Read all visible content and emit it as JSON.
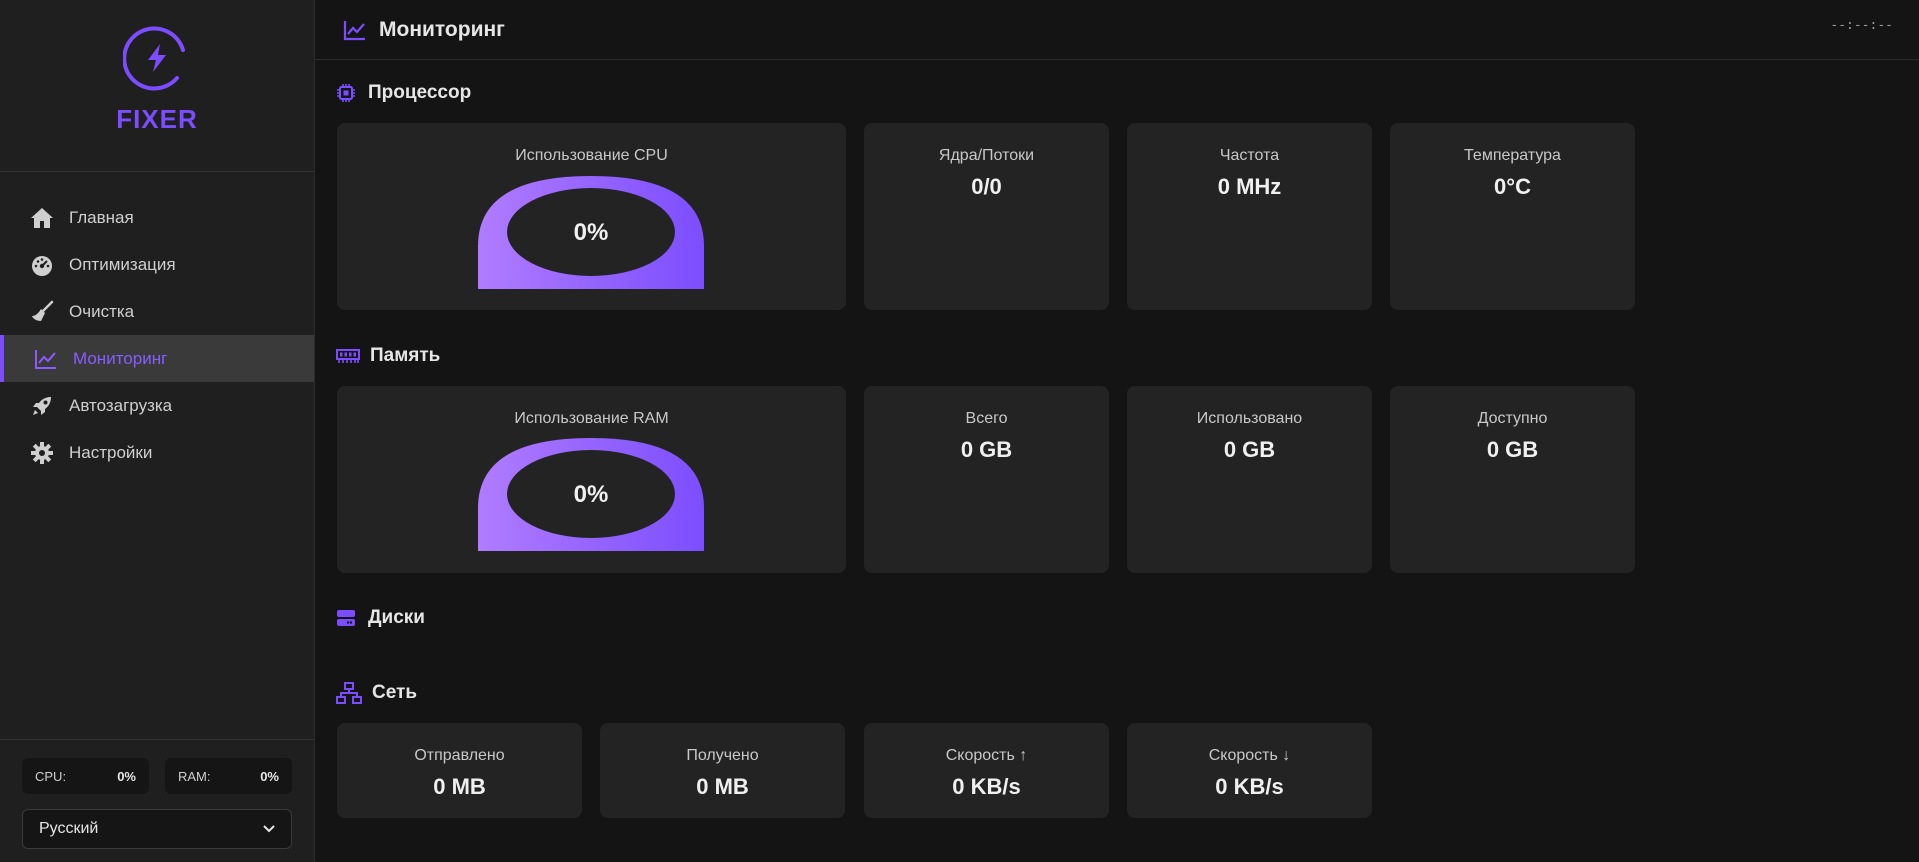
{
  "app": {
    "logo_text": "FIXER",
    "accent_color": "#7c4dff"
  },
  "sidebar": {
    "items": [
      {
        "label": "Главная",
        "icon": "home-icon"
      },
      {
        "label": "Оптимизация",
        "icon": "speedometer-icon"
      },
      {
        "label": "Очистка",
        "icon": "broom-icon"
      },
      {
        "label": "Мониторинг",
        "icon": "chart-line-icon",
        "active": true
      },
      {
        "label": "Автозагрузка",
        "icon": "rocket-icon"
      },
      {
        "label": "Настройки",
        "icon": "gear-icon"
      }
    ],
    "cpu_label": "CPU:",
    "cpu_value": "0%",
    "ram_label": "RAM:",
    "ram_value": "0%",
    "language": "Русский"
  },
  "header": {
    "title": "Мониторинг",
    "clock": "--:--:--"
  },
  "processor": {
    "title": "Процессор",
    "usage_label": "Использование CPU",
    "usage_value": "0%",
    "cards": [
      {
        "label": "Ядра/Потоки",
        "value": "0/0"
      },
      {
        "label": "Частота",
        "value": "0 MHz"
      },
      {
        "label": "Температура",
        "value": "0°C"
      }
    ]
  },
  "memory": {
    "title": "Память",
    "usage_label": "Использование RAM",
    "usage_value": "0%",
    "cards": [
      {
        "label": "Всего",
        "value": "0 GB"
      },
      {
        "label": "Использовано",
        "value": "0 GB"
      },
      {
        "label": "Доступно",
        "value": "0 GB"
      }
    ]
  },
  "disks": {
    "title": "Диски"
  },
  "network": {
    "title": "Сеть",
    "cards": [
      {
        "label": "Отправлено",
        "value": "0 MB"
      },
      {
        "label": "Получено",
        "value": "0 MB"
      },
      {
        "label": "Скорость ↑",
        "value": "0 KB/s"
      },
      {
        "label": "Скорость ↓",
        "value": "0 KB/s"
      }
    ]
  }
}
